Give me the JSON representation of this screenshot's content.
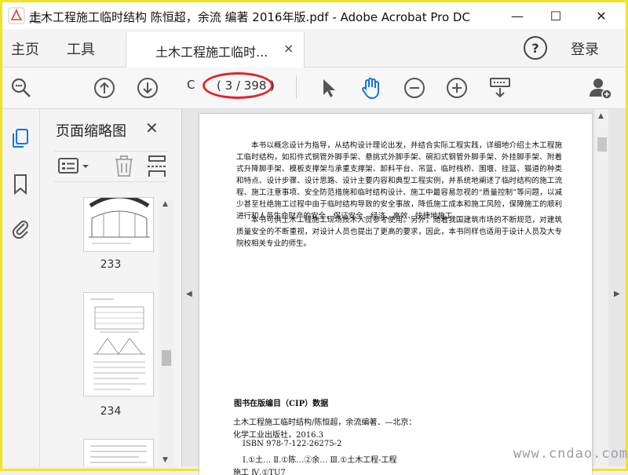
{
  "window": {
    "title": "土木工程施工临时结构 陈恒超，余流 编著 2016年版.pdf - Adobe Acrobat Pro DC",
    "minimize": "—",
    "maximize": "☐",
    "close": "✕"
  },
  "watermark_logo": "走",
  "menu": {
    "home": "主页",
    "tools": "工具",
    "help": "?",
    "login": "登录"
  },
  "tab": {
    "label": "土木工程施工临时...",
    "close": "×"
  },
  "toolbar": {
    "page_input": "C",
    "page_count": "( 3 / 398 )"
  },
  "thumbnail_panel": {
    "title": "页面缩略图",
    "close": "✕",
    "thumbnails": [
      {
        "label": "233"
      },
      {
        "label": "234"
      },
      {
        "label": ""
      }
    ]
  },
  "document": {
    "paragraphs": [
      "本书以概念设计为指导，从结构设计理论出发，并结合实际工程实践，详细地介绍土木工程施工临时结构，如扣件式钢管外脚手架、悬挑式外脚手架、碗扣式钢管外脚手架、外挂脚手架、附着式升降脚手架、模板支撑架与承重支撑架、卸料平台、吊篮、临时栈桥、围堰、挂篮、猫道的种类和特点、设计步骤、设计思路、设计主要内容和典型工程实例，并系统地阐述了临时结构的施工流程、施工注意事项、安全防范措施和临时结构设计、施工中最容易忽视的“质量控制”等问题，以减少甚至杜绝施工过程中由于临时结构导致的安全事故，降低施工成本和施工风险，保障施工的顺利进行和人员生命财产的安全，保证安全、经济、高效、快捷地施工。",
      "本书可供土木工程施工现场技术人员参考使用。另外，随着我国建筑市场的不断规范，对建筑质量安全的不断重视，对设计人员也提出了更高的要求，因此，本书同样也适用于设计人员及大专院校相关专业的师生。"
    ],
    "cip_heading": "图书在版编目（CIP）数据",
    "cip_lines": [
      "土木工程施工临时结构/陈恒超，余流编著．—北京：",
      "化学工业出版社，2016.3",
      "ISBN 978-7-122-26275-2",
      "Ⅰ.①土…  Ⅱ.①陈…②余…  Ⅲ.①土木工程-工程",
      "施工  Ⅳ.①TU7"
    ]
  },
  "watermark": "www.cndao.com",
  "colors": {
    "highlight_oval": "#e0262a",
    "accent_blue": "#1473e6",
    "frame": "#f2e22a"
  }
}
